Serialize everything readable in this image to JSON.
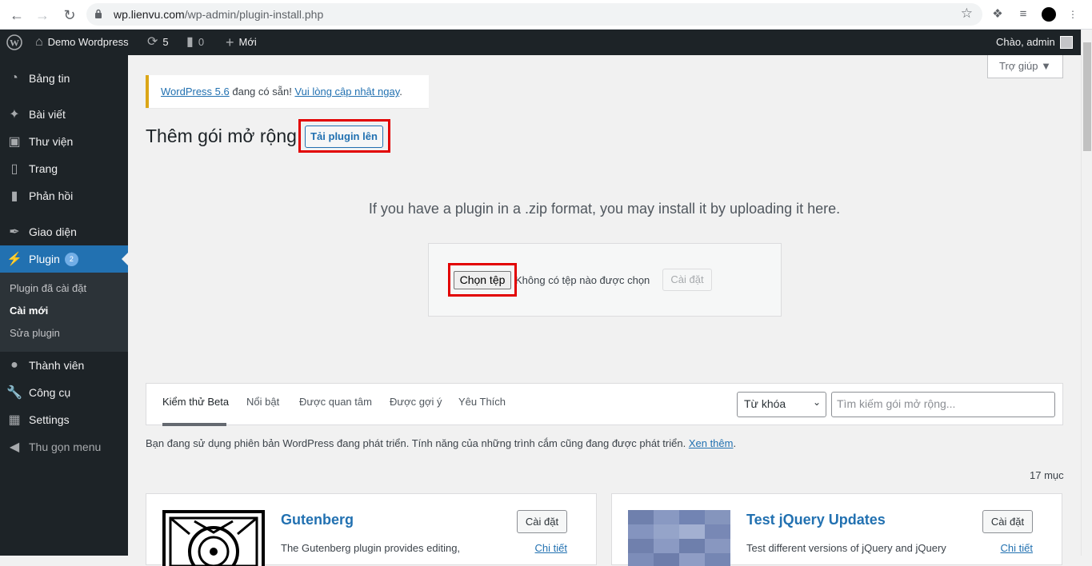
{
  "browser": {
    "url_host": "wp.lienvu.com",
    "url_path": "/wp-admin/plugin-install.php"
  },
  "adminbar": {
    "site_name": "Demo Wordpress",
    "updates_count": "5",
    "comments_count": "0",
    "new_label": "Mới",
    "greeting": "Chào, admin"
  },
  "sidebar": {
    "items": [
      {
        "label": "Bảng tin",
        "icon": "dashboard-icon"
      },
      {
        "label": "Bài viết",
        "icon": "pin-icon"
      },
      {
        "label": "Thư viện",
        "icon": "media-icon"
      },
      {
        "label": "Trang",
        "icon": "page-icon"
      },
      {
        "label": "Phản hồi",
        "icon": "comment-icon"
      },
      {
        "label": "Giao diện",
        "icon": "brush-icon"
      },
      {
        "label": "Plugin",
        "icon": "plugin-icon",
        "badge": "2"
      },
      {
        "label": "Thành viên",
        "icon": "user-icon"
      },
      {
        "label": "Công cụ",
        "icon": "wrench-icon"
      },
      {
        "label": "Settings",
        "icon": "settings-icon"
      },
      {
        "label": "Thu gọn menu",
        "icon": "collapse-icon"
      }
    ],
    "submenu": [
      "Plugin đã cài đặt",
      "Cài mới",
      "Sửa plugin"
    ]
  },
  "main": {
    "help_label": "Trợ giúp ▼",
    "notice": {
      "link1": "WordPress 5.6",
      "text": " đang có sẵn! ",
      "link2": "Vui lòng cập nhật ngay",
      "end": "."
    },
    "page_title": "Thêm gói mở rộng",
    "upload_button": "Tải plugin lên",
    "intro": "If you have a plugin in a .zip format, you may install it by uploading it here.",
    "choose_file": "Chọn tệp",
    "no_file": "Không có tệp nào được chọn",
    "install_now": "Cài đặt",
    "tabs": [
      "Kiểm thử Beta",
      "Nổi bật",
      "Được quan tâm",
      "Được gợi ý",
      "Yêu Thích"
    ],
    "search_type": "Từ khóa",
    "search_placeholder": "Tìm kiếm gói mở rộng...",
    "beta_note": "Bạn đang sử dụng phiên bản WordPress đang phát triển. Tính năng của những trình cắm cũng đang được phát triển. ",
    "beta_link": "Xen thêm",
    "beta_end": ".",
    "count": "17 mục",
    "cards": [
      {
        "name": "Gutenberg",
        "desc": "The Gutenberg plugin provides editing,",
        "install": "Cài đặt",
        "more": "Chi tiết"
      },
      {
        "name": "Test jQuery Updates",
        "desc": "Test different versions of jQuery and jQuery",
        "install": "Cài đặt",
        "more": "Chi tiết"
      }
    ]
  },
  "colors": {
    "admin_bar": "#1d2327",
    "accent": "#2271b1",
    "highlight_box": "#e20000"
  }
}
